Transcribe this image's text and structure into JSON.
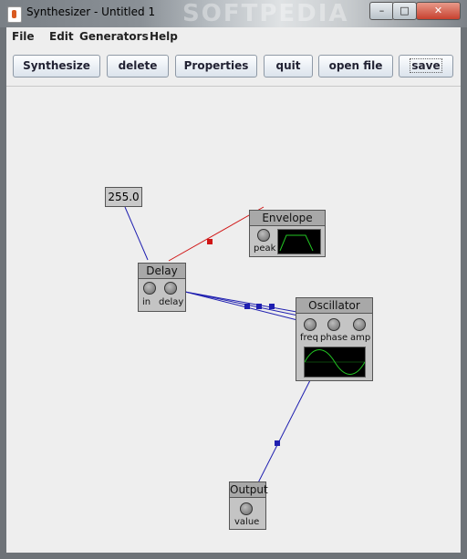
{
  "window": {
    "title": "Synthesizer - Untitled 1",
    "watermark": "SOFTPEDIA",
    "controls": {
      "minimize": "–",
      "maximize": "□",
      "close": "✕"
    }
  },
  "menu": [
    "File",
    "Edit",
    "Generators",
    "Help"
  ],
  "toolbar": {
    "synthesize": "Synthesize",
    "delete": "delete",
    "properties": "Properties",
    "quit": "quit",
    "open_file": "open file",
    "save": "save"
  },
  "canvas": {
    "constant": {
      "value": "255.0"
    },
    "envelope": {
      "title": "Envelope",
      "ports": [
        "peak"
      ]
    },
    "delay": {
      "title": "Delay",
      "ports": [
        "in",
        "delay"
      ]
    },
    "oscillator": {
      "title": "Oscillator",
      "ports": [
        "freq",
        "phase",
        "amp"
      ]
    },
    "output": {
      "title": "Output",
      "ports": [
        "value"
      ]
    }
  },
  "colors": {
    "wire_blue": "#1f1fb0",
    "wire_red": "#d01515",
    "scope_trace": "#22c322",
    "canvas_bg": "#eeeeee",
    "node_body": "#c4c4c4",
    "node_header": "#a8a8a8"
  }
}
